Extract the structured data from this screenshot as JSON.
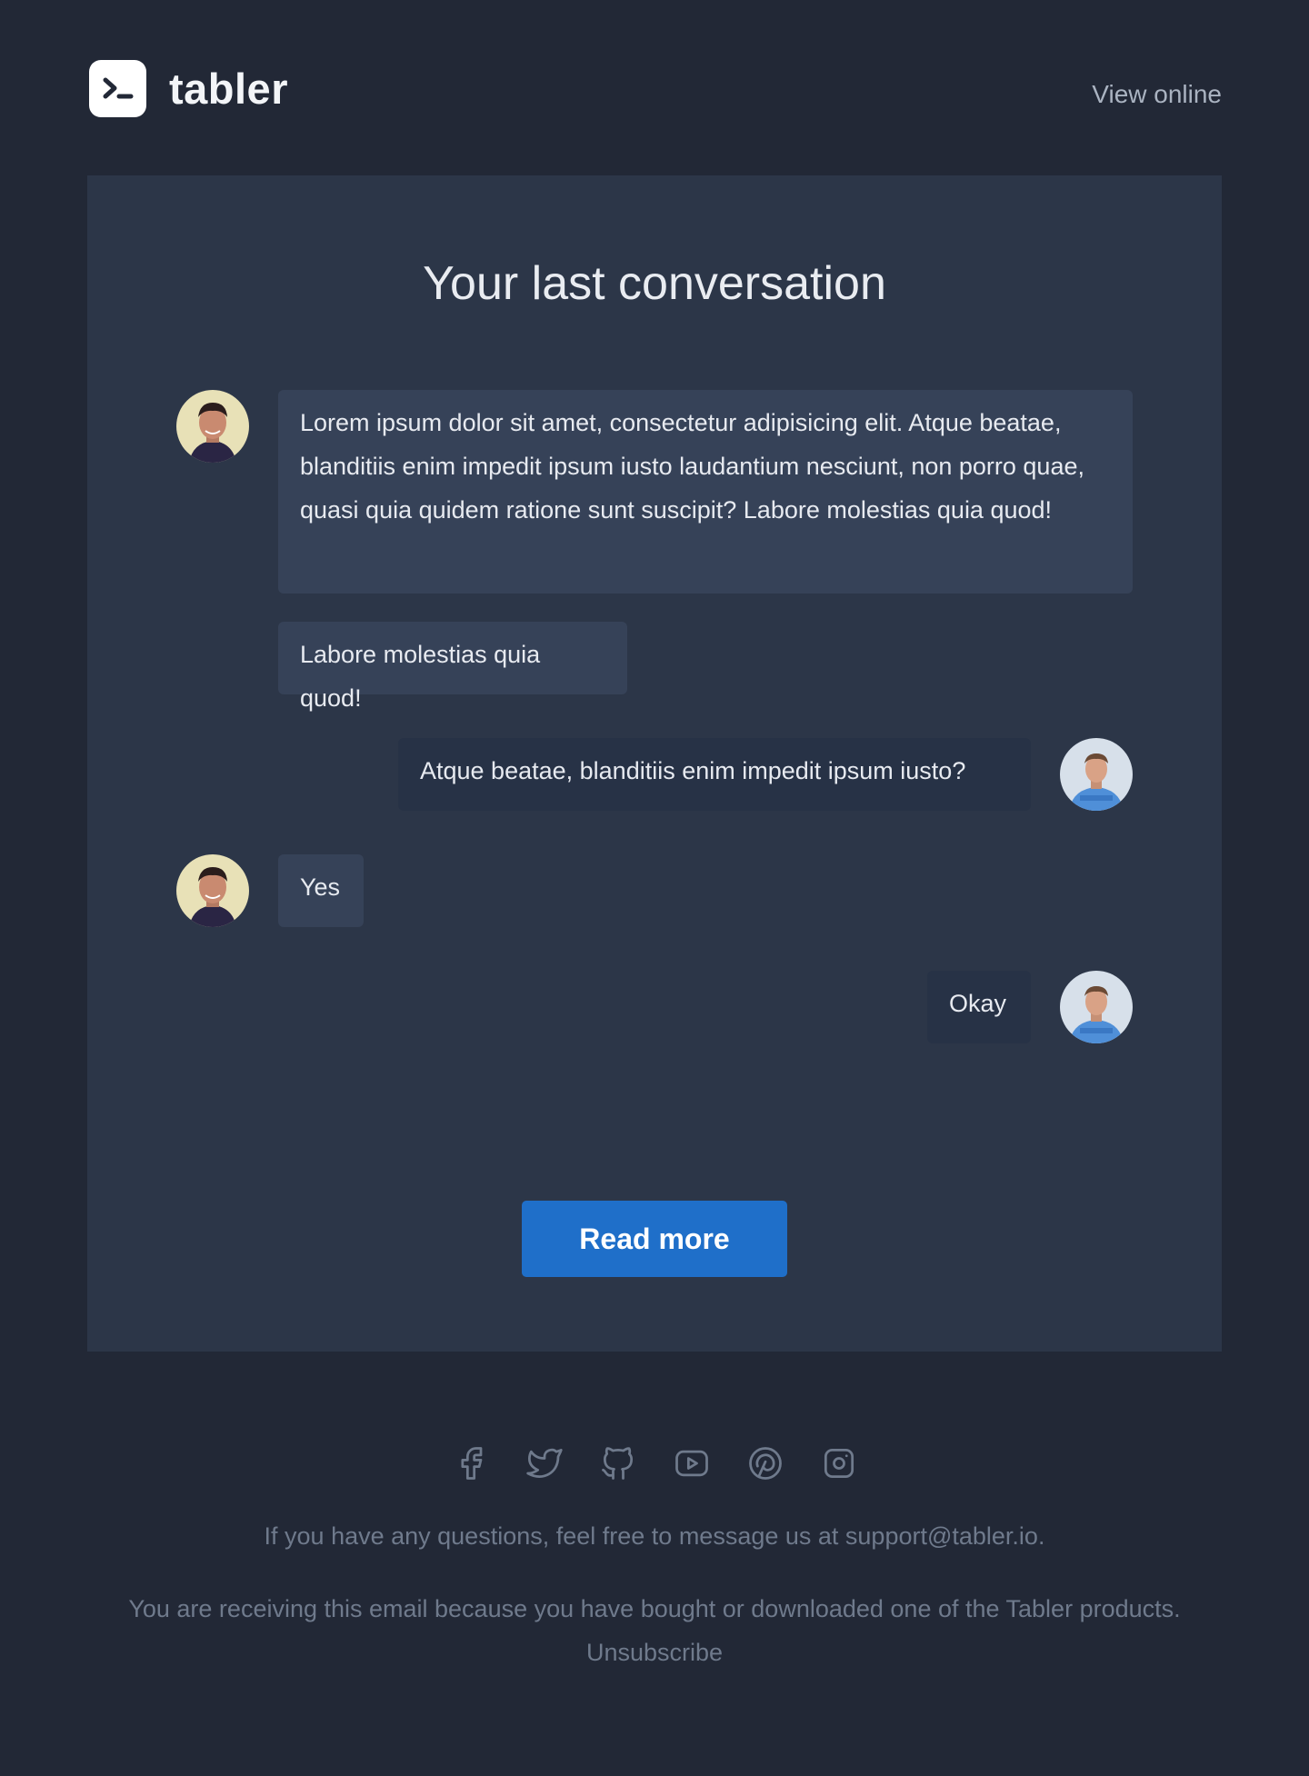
{
  "header": {
    "brand": "tabler",
    "view_online": "View online"
  },
  "card": {
    "title": "Your last conversation",
    "messages": [
      {
        "sender": "left",
        "avatar": "man-avatar-1",
        "text": "Lorem ipsum dolor sit amet, consectetur adipisicing elit. Atque beatae, blanditiis enim impedit ipsum iusto laudantium nesciunt, non porro quae, quasi quia quidem ratione sunt suscipit? Labore molestias quia quod!"
      },
      {
        "sender": "left",
        "avatar": "",
        "text": "Labore molestias quia quod!"
      },
      {
        "sender": "right",
        "avatar": "man-avatar-2",
        "text": "Atque beatae, blanditiis enim impedit ipsum iusto?"
      },
      {
        "sender": "left",
        "avatar": "man-avatar-1",
        "text": "Yes"
      },
      {
        "sender": "right",
        "avatar": "man-avatar-2",
        "text": "Okay"
      }
    ],
    "button": "Read more"
  },
  "footer": {
    "social_icons": [
      "facebook-icon",
      "twitter-icon",
      "github-icon",
      "youtube-icon",
      "pinterest-icon",
      "instagram-icon"
    ],
    "questions": "If you have any questions, feel free to message us at support@tabler.io.",
    "receiving": "You are receiving this email because you have bought or downloaded one of the Tabler products.",
    "unsubscribe": "Unsubscribe"
  },
  "colors": {
    "background": "#222836",
    "card": "#2c3648",
    "bubble_left": "#364258",
    "bubble_right": "#273246",
    "button": "#1f6fc9",
    "footer_text": "#6f7a8c"
  }
}
